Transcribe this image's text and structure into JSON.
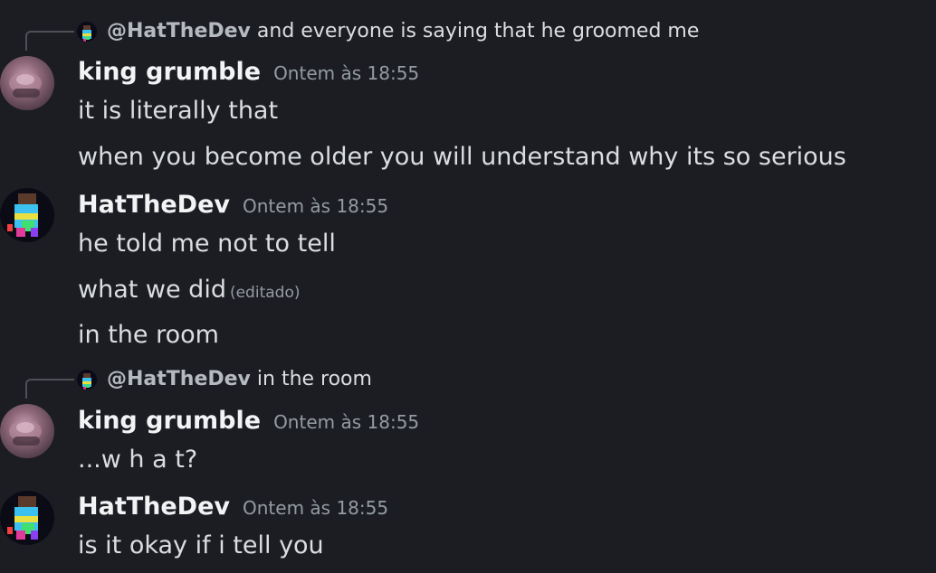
{
  "colors": {
    "background": "#1c1d22",
    "text": "#dbdee1",
    "username": "#f2f3f5",
    "muted": "#949ba4",
    "mention": "#b5bac1"
  },
  "messages": [
    {
      "reply": {
        "mention": "@HatTheDev",
        "text": "and everyone is saying that he groomed me",
        "avatar_icon": "hatthedev-avatar-icon"
      },
      "author": "king grumble",
      "timestamp": "Ontem às 18:55",
      "avatar_icon": "king-grumble-avatar-icon",
      "lines": [
        {
          "text": "it is literally that"
        },
        {
          "text": "when you become older you will understand why its so serious"
        }
      ]
    },
    {
      "author": "HatTheDev",
      "timestamp": "Ontem às 18:55",
      "avatar_icon": "hatthedev-avatar-icon",
      "lines": [
        {
          "text": "he told me not to tell"
        },
        {
          "text": "what we did",
          "edited": "(editado)"
        },
        {
          "text": "in the room"
        }
      ]
    },
    {
      "reply": {
        "mention": "@HatTheDev",
        "text": "in the room",
        "avatar_icon": "hatthedev-avatar-icon"
      },
      "author": "king grumble",
      "timestamp": "Ontem às 18:55",
      "avatar_icon": "king-grumble-avatar-icon",
      "lines": [
        {
          "text": "...w h a t?"
        }
      ]
    },
    {
      "author": "HatTheDev",
      "timestamp": "Ontem às 18:55",
      "avatar_icon": "hatthedev-avatar-icon",
      "lines": [
        {
          "text": "is it okay if i tell you"
        }
      ]
    }
  ]
}
